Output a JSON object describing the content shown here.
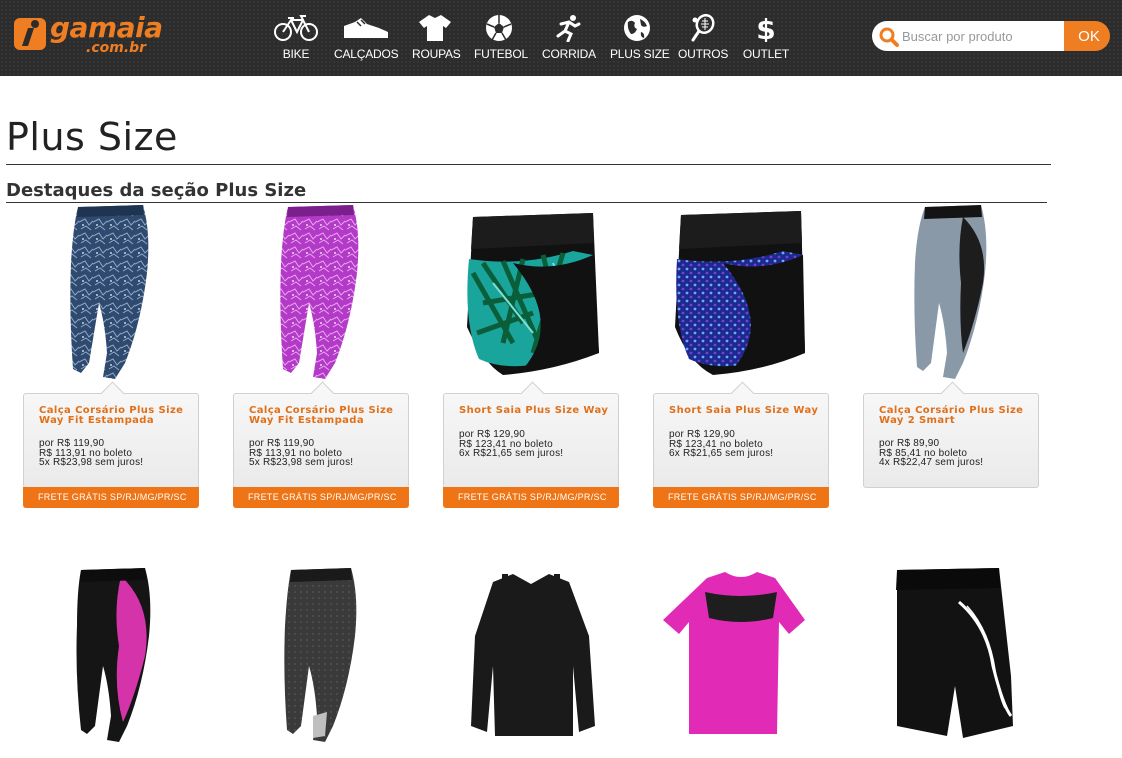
{
  "header": {
    "logo_text": "gamaia",
    "logo_sub": ".com.br",
    "nav": [
      {
        "label": "BIKE",
        "icon": "bike-icon"
      },
      {
        "label": "CALÇADOS",
        "icon": "sneaker-icon"
      },
      {
        "label": "ROUPAS",
        "icon": "tshirt-icon"
      },
      {
        "label": "FUTEBOL",
        "icon": "soccer-ball-icon"
      },
      {
        "label": "CORRIDA",
        "icon": "runner-icon"
      },
      {
        "label": "PLUS SIZE",
        "icon": "globe-icon"
      },
      {
        "label": "OUTROS",
        "icon": "tennis-racket-icon"
      },
      {
        "label": "OUTLET",
        "icon": "dollar-icon"
      }
    ],
    "search": {
      "placeholder": "Buscar por produto",
      "button_label": "OK"
    }
  },
  "page": {
    "title": "Plus Size",
    "section_title": "Destaques da seção Plus Size"
  },
  "colors": {
    "accent": "#ef7d22",
    "header_bg": "#2c2c2c",
    "ship_bar": "#ef7415"
  },
  "products": [
    {
      "name": "Calça Corsário Plus Size Way Fit Estampada",
      "price": "por R$ 119,90",
      "boleto": "R$ 113,91 no boleto",
      "installments": "5x R$23,98 sem juros!",
      "shipping": "FRETE GRÁTIS SP/RJ/MG/PR/SC"
    },
    {
      "name": "Calça Corsário Plus Size Way Fit Estampada",
      "price": "por R$ 119,90",
      "boleto": "R$ 113,91 no boleto",
      "installments": "5x R$23,98 sem juros!",
      "shipping": "FRETE GRÁTIS SP/RJ/MG/PR/SC"
    },
    {
      "name": "Short Saia Plus Size Way",
      "price": "por R$ 129,90",
      "boleto": "R$ 123,41 no boleto",
      "installments": "6x R$21,65 sem juros!",
      "shipping": "FRETE GRÁTIS SP/RJ/MG/PR/SC"
    },
    {
      "name": "Short Saia Plus Size Way",
      "price": "por R$ 129,90",
      "boleto": "R$ 123,41 no boleto",
      "installments": "6x R$21,65 sem juros!",
      "shipping": "FRETE GRÁTIS SP/RJ/MG/PR/SC"
    },
    {
      "name": "Calça Corsário Plus Size Way 2 Smart",
      "price": "por R$ 89,90",
      "boleto": "R$ 85,41 no boleto",
      "installments": "4x R$22,47 sem juros!",
      "shipping": ""
    }
  ]
}
